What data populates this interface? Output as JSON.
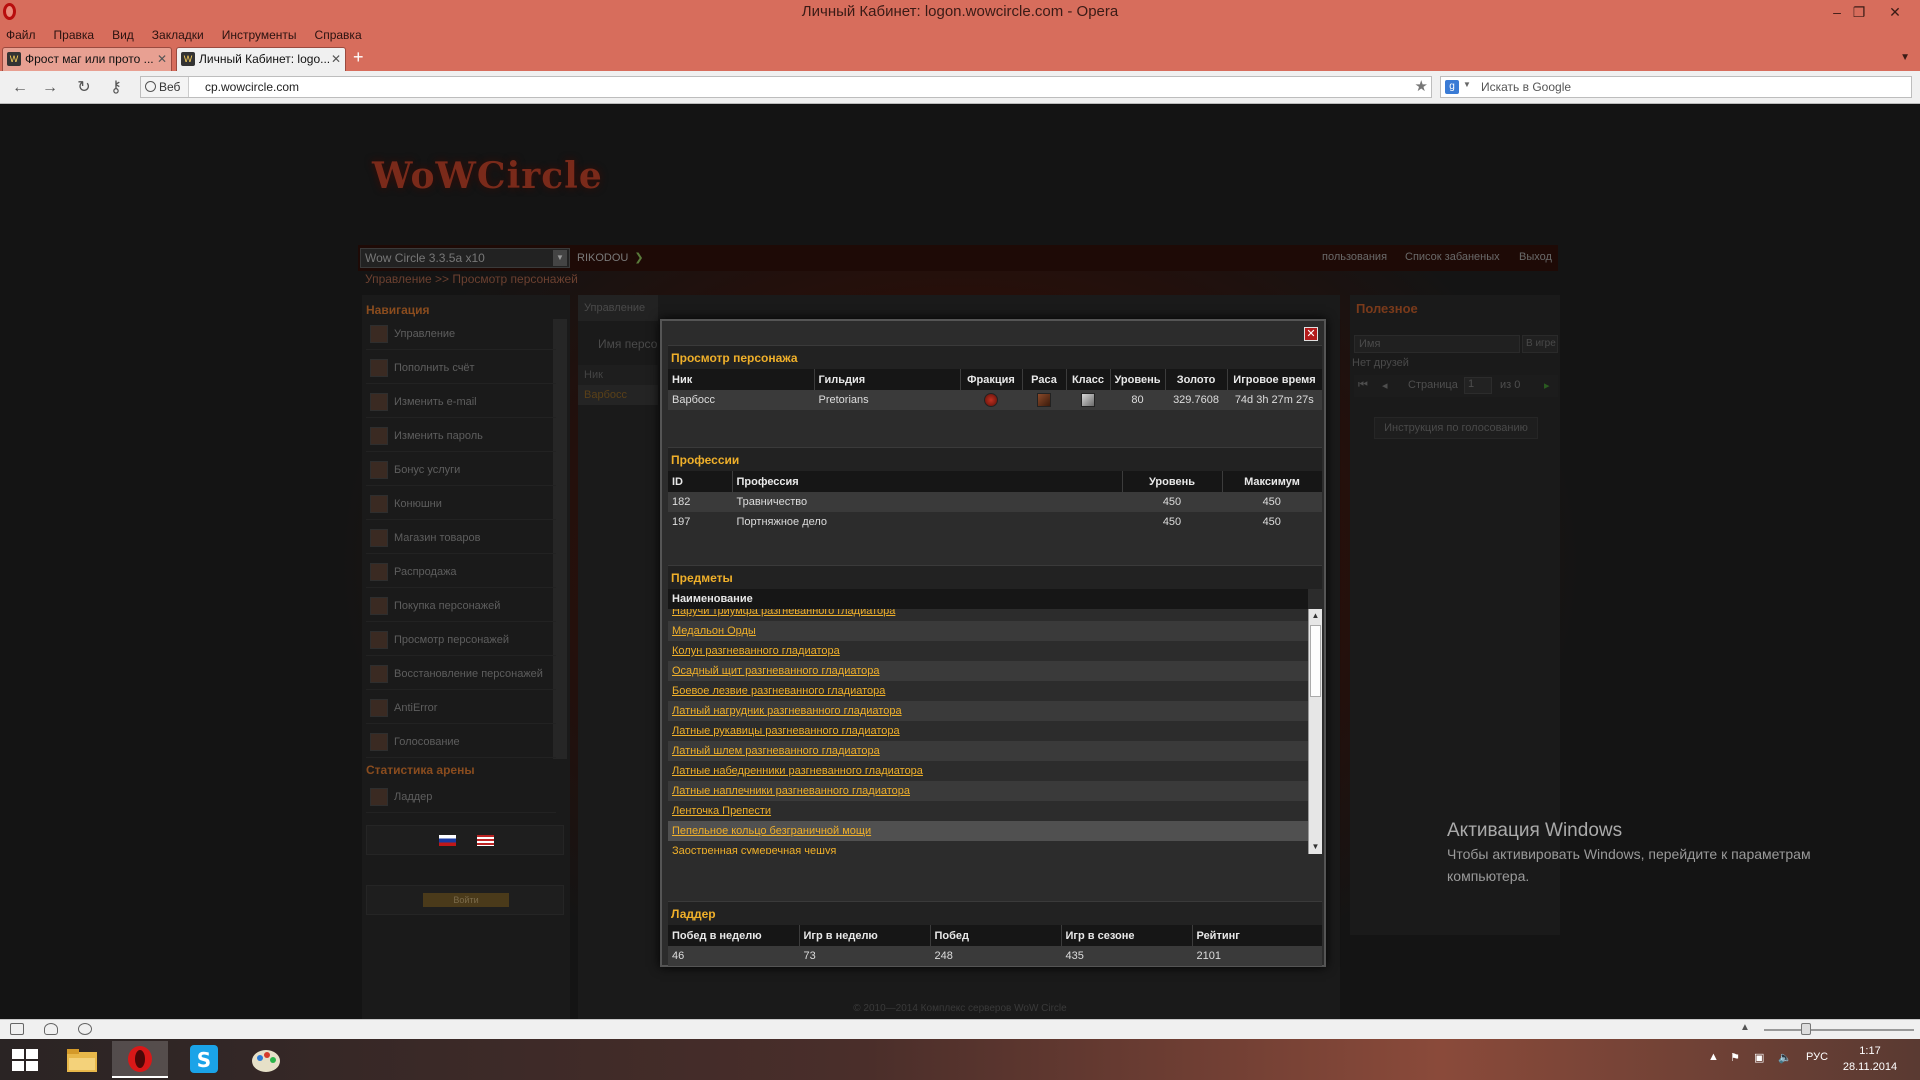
{
  "window": {
    "title": "Личный Кабинет: logon.wowcircle.com - Opera"
  },
  "menu": [
    "Файл",
    "Правка",
    "Вид",
    "Закладки",
    "Инструменты",
    "Справка"
  ],
  "tabs": [
    {
      "label": "Фрост маг или прото ...",
      "active": false
    },
    {
      "label": "Личный Кабинет: logo...",
      "active": true
    }
  ],
  "address": {
    "badge": "Веб",
    "url": "cp.wowcircle.com",
    "search_placeholder": "Искать в Google"
  },
  "site": {
    "logo": "WoWCircle",
    "server": "Wow Circle 3.3.5a x10",
    "account": "RIKODOU",
    "top_links": [
      "пользования",
      "Список забаненых",
      "Выход"
    ],
    "breadcrumb": "Управление >> Просмотр персонажей",
    "bg_tab": "Управление",
    "bg_search_label": "Имя персо",
    "bg_col": "Ник",
    "bg_row": "Варбосс"
  },
  "sidebar": {
    "nav_title": "Навигация",
    "items": [
      "Управление",
      "Пополнить счёт",
      "Изменить e-mail",
      "Изменить пароль",
      "Бонус услуги",
      "Конюшни",
      "Магазин товаров",
      "Распродажа",
      "Покупка персонажей",
      "Просмотр персонажей",
      "Восстановление персонажей",
      "AntiError",
      "Голосование"
    ],
    "arena_title": "Статистика арены",
    "arena_items": [
      "Ладдер"
    ],
    "login_label": "Войти"
  },
  "right_col": {
    "title": "Полезное",
    "name_placeholder": "Имя",
    "ingame": "В игре",
    "no_friends": "Нет друзей",
    "page_label": "Страница",
    "page_value": "1",
    "page_of": "из 0",
    "vote_button": "Инструкция по голосованию"
  },
  "footer": {
    "copyright": "© 2010—2014 Комплекс серверов WoW Circle"
  },
  "modal": {
    "char_title": "Просмотр персонажа",
    "char_headers": [
      "Ник",
      "Гильдия",
      "Фракция",
      "Раса",
      "Класс",
      "Уровень",
      "Золото",
      "Игровое время"
    ],
    "character": {
      "nick": "Варбосс",
      "guild": "Pretorians",
      "faction_icon": "horde-icon",
      "race_icon": "race-icon",
      "class_icon": "warrior-icon",
      "level": "80",
      "gold": "329.7608",
      "playtime": "74d 3h 27m 27s"
    },
    "prof_title": "Профессии",
    "prof_headers": [
      "ID",
      "Профессия",
      "Уровень",
      "Максимум"
    ],
    "professions": [
      {
        "id": "182",
        "name": "Травничество",
        "level": "450",
        "max": "450"
      },
      {
        "id": "197",
        "name": "Портняжное дело",
        "level": "450",
        "max": "450"
      }
    ],
    "items_title": "Предметы",
    "items_header": "Наименование",
    "items": [
      "Наручи триумфа разгневанного гладиатора",
      "Медальон Орды",
      "Колун разгневанного гладиатора",
      "Осадный щит разгневанного гладиатора",
      "Боевое лезвие разгневанного гладиатора",
      "Латный нагрудник разгневанного гладиатора",
      "Латные рукавицы разгневанного гладиатора",
      "Латный шлем разгневанного гладиатора",
      "Латные набедренники разгневанного гладиатора",
      "Латные наплечники разгневанного гладиатора",
      "Ленточка Препести",
      "Пепельное кольцо безграничной мощи",
      "Заостренная сумеречная чешуя"
    ],
    "ladder_title": "Ладдер",
    "ladder_headers": [
      "Побед в неделю",
      "Игр в неделю",
      "Побед",
      "Игр в сезоне",
      "Рейтинг"
    ],
    "ladder": [
      "46",
      "73",
      "248",
      "435",
      "2101"
    ]
  },
  "activation": {
    "title": "Активация Windows",
    "text1": "Чтобы активировать Windows, перейдите к параметрам",
    "text2": "компьютера."
  },
  "taskbar": {
    "apps": [
      "file-explorer-icon",
      "opera-icon",
      "skype-icon",
      "paint-icon"
    ],
    "lang": "РУС",
    "time": "1:17",
    "date": "28.11.2014"
  },
  "colors": {
    "accent_gold": "#f0b02a",
    "chrome": "#d76d5c",
    "close_red": "#b21a1a"
  }
}
